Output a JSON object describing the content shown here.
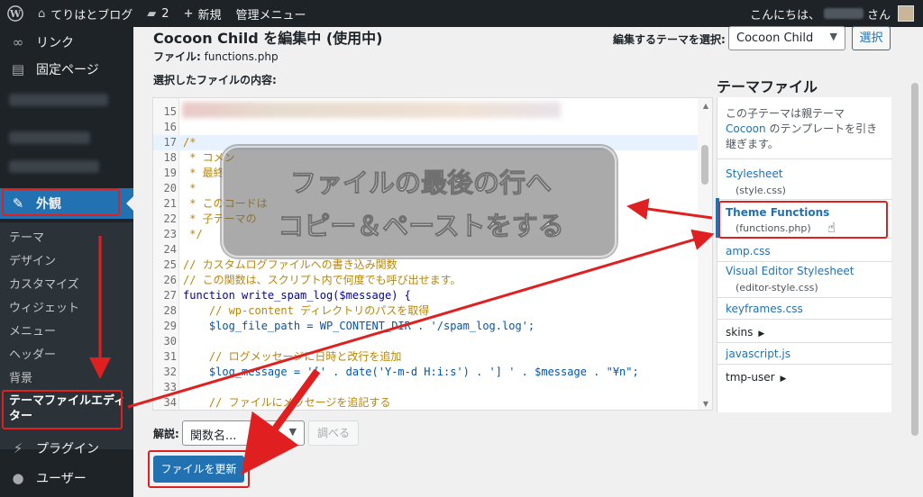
{
  "adminbar": {
    "site_name": "てりはとブログ",
    "comments_count": "2",
    "new_label": "新規",
    "admin_menu_label": "管理メニュー",
    "greeting_prefix": "こんにちは、",
    "greeting_suffix": "さん"
  },
  "sidebar": {
    "items": [
      {
        "label": "リンク",
        "icon": "link-icon"
      },
      {
        "label": "固定ページ",
        "icon": "page-icon"
      },
      {
        "label": "外観",
        "icon": "appearance-icon"
      },
      {
        "label": "プラグイン",
        "icon": "plugin-icon"
      },
      {
        "label": "ユーザー",
        "icon": "user-icon"
      }
    ],
    "submenu": [
      "テーマ",
      "デザイン",
      "カスタマイズ",
      "ウィジェット",
      "メニュー",
      "ヘッダー",
      "背景",
      "テーマファイルエディター"
    ]
  },
  "main": {
    "title": "Cocoon Child を編集中 (使用中)",
    "file_prefix": "ファイル:",
    "file_name": "functions.php",
    "select_theme_label": "編集するテーマを選択:",
    "selected_theme": "Cocoon Child",
    "select_button": "選択",
    "content_label": "選択したファイルの内容:"
  },
  "editor": {
    "lines": [
      {
        "n": "15",
        "text": ""
      },
      {
        "n": "16",
        "text": ""
      },
      {
        "n": "17",
        "text": "/*"
      },
      {
        "n": "18",
        "text": " * コメン"
      },
      {
        "n": "19",
        "text": " * 最終"
      },
      {
        "n": "20",
        "text": " *"
      },
      {
        "n": "21",
        "text": " * このコードは"
      },
      {
        "n": "22",
        "text": " * 子テーマの"
      },
      {
        "n": "23",
        "text": " */"
      },
      {
        "n": "24",
        "text": ""
      },
      {
        "n": "25",
        "text": "// カスタムログファイルへの書き込み関数"
      },
      {
        "n": "26",
        "text": "// この関数は、スクリプト内で何度でも呼び出せます。"
      },
      {
        "n": "27",
        "text": "function write_spam_log($message) {"
      },
      {
        "n": "28",
        "text": "    // wp-content ディレクトリのパスを取得"
      },
      {
        "n": "29",
        "text": "    $log_file_path = WP_CONTENT_DIR . '/spam_log.log';"
      },
      {
        "n": "30",
        "text": ""
      },
      {
        "n": "31",
        "text": "    // ログメッセージに日時と改行を追加"
      },
      {
        "n": "32",
        "text": "    $log_message = '[' . date('Y-m-d H:i:s') . '] ' . $message . \"¥n\";"
      },
      {
        "n": "33",
        "text": ""
      },
      {
        "n": "34",
        "text": "    // ファイルにメッセージを追記する"
      }
    ]
  },
  "overlay": {
    "line1": "ファイルの最後の行へ",
    "line2": "コピー＆ペーストをする"
  },
  "theme_files": {
    "heading": "テーマファイル",
    "desc_prefix": "この子テーマは親テーマ",
    "desc_link": "Cocoon",
    "desc_suffix": "のテンプレートを引き継ぎます。",
    "files": [
      {
        "label": "Stylesheet",
        "sub": "(style.css)"
      },
      {
        "label": "Theme Functions",
        "sub": "(functions.php)"
      },
      {
        "label": "amp.css",
        "sub": ""
      },
      {
        "label": "Visual Editor Stylesheet",
        "sub": "(editor-style.css)"
      },
      {
        "label": "keyframes.css",
        "sub": ""
      },
      {
        "label": "skins",
        "sub": ""
      },
      {
        "label": "javascript.js",
        "sub": ""
      },
      {
        "label": "tmp-user",
        "sub": ""
      }
    ]
  },
  "bottom": {
    "doc_label": "解説:",
    "doc_placeholder": "関数名...",
    "lookup_button": "調べる",
    "update_button": "ファイルを更新"
  },
  "colors": {
    "accent": "#2271b1",
    "annotation_red": "#e02020",
    "adminbar_bg": "#1d2327"
  }
}
